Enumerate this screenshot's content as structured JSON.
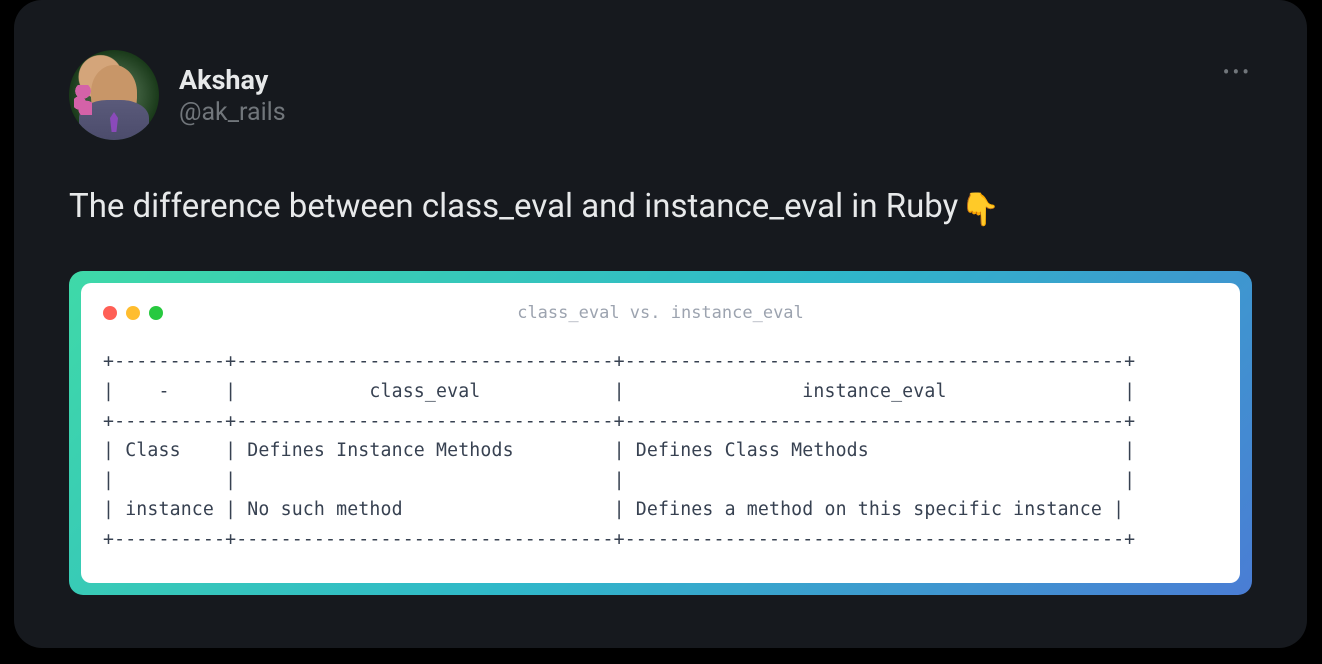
{
  "author": {
    "display_name": "Akshay",
    "handle": "@ak_rails"
  },
  "tweet": {
    "text": "The difference between class_eval and instance_eval in Ruby",
    "emoji": "👇"
  },
  "code_window": {
    "title": "class_eval vs. instance_eval"
  },
  "table": {
    "columns": [
      "-",
      "class_eval",
      "instance_eval"
    ],
    "rows": [
      {
        "label": "Class",
        "class_eval": "Defines Instance Methods",
        "instance_eval": "Defines Class Methods"
      },
      {
        "label": "instance",
        "class_eval": "No such method",
        "instance_eval": "Defines a method on this specific instance"
      }
    ],
    "ascii": "+----------+----------------------------------+---------------------------------------------+\n|    -     |            class_eval            |                instance_eval                |\n+----------+----------------------------------+---------------------------------------------+\n| Class    | Defines Instance Methods         | Defines Class Methods                       |\n|          |                                  |                                             |\n| instance | No such method                   | Defines a method on this specific instance |\n+----------+----------------------------------+---------------------------------------------+"
  }
}
